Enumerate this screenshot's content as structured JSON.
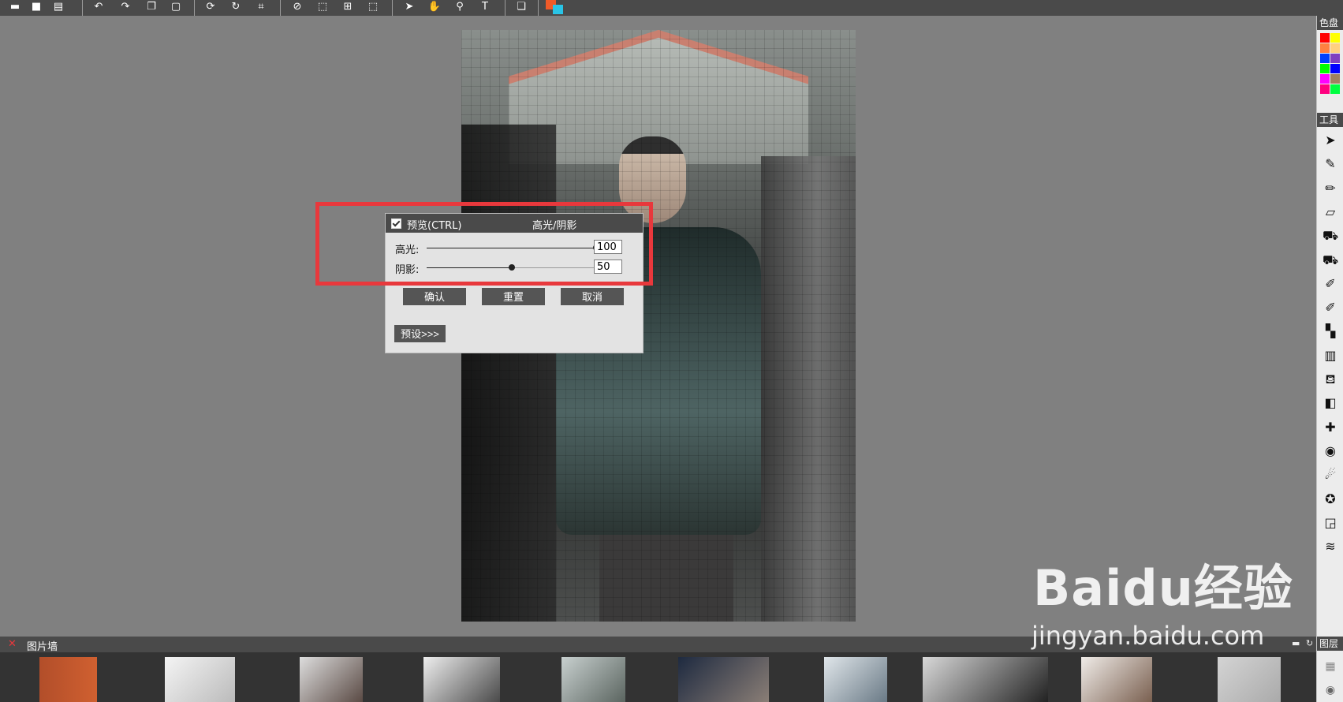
{
  "toolbar": {
    "icons": [
      "open-icon",
      "save-icon",
      "print-icon",
      "undo-icon",
      "redo-icon",
      "copy-icon",
      "paste-icon",
      "rotate-icon",
      "refresh-icon",
      "crop-icon",
      "eraser-icon",
      "select-icon",
      "magic-select-icon",
      "marquee-icon",
      "pointer-icon",
      "hand-icon",
      "zoom-icon",
      "text-icon",
      "layers-icon"
    ],
    "colors": {
      "primary": "#f05a28",
      "secondary": "#29c4e6"
    }
  },
  "dialog": {
    "preview_label": "预览(CTRL)",
    "title": "高光/阴影",
    "highlight": {
      "label": "高光:",
      "value": "100",
      "fraction": 1.0
    },
    "shadow": {
      "label": "阴影:",
      "value": "50",
      "fraction": 0.5
    },
    "confirm": "确认",
    "reset": "重置",
    "cancel": "取消",
    "preset": "预设>>>"
  },
  "right_panel": {
    "palette_title": "色盘",
    "palette": [
      "#ff0000",
      "#ffff00",
      "#ff8040",
      "#ffd080",
      "#0040ff",
      "#8040c0",
      "#00ff00",
      "#0000ff",
      "#ff00ff",
      "#a08060",
      "#ff0080",
      "#00ff40"
    ],
    "tools_title": "工具",
    "tools": [
      "pointer-icon",
      "brush-icon",
      "pencil-icon",
      "eraser-icon",
      "stamp-icon",
      "stamp2-icon",
      "dodge-icon",
      "burn-icon",
      "mosaic-icon",
      "gradient-icon",
      "fill-icon",
      "gradient2-icon",
      "heal-icon",
      "redeye-icon",
      "smudge-icon",
      "star-icon",
      "shape-icon",
      "wave-icon"
    ],
    "layers_title": "图层"
  },
  "bottom": {
    "title": "图片墙"
  },
  "watermark": {
    "main": "Baidu经验",
    "sub": "jingyan.baidu.com"
  }
}
